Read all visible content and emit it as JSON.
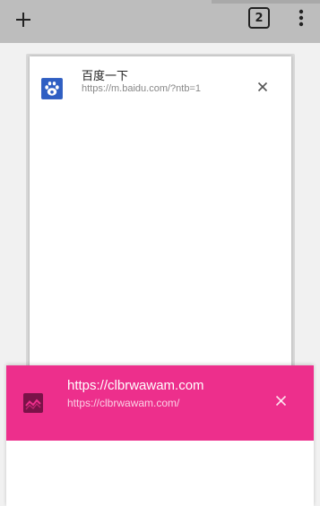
{
  "toolbar": {
    "new_tab_icon": "plus-icon",
    "tab_count": "2",
    "menu_icon": "more-vert-icon",
    "background_color": "#bdbdbd"
  },
  "tabs": [
    {
      "title": "百度一下",
      "url": "https://m.baidu.com/?ntb=1",
      "favicon": "baidu-paw-icon",
      "close_icon": "close-icon"
    },
    {
      "title": "https://clbrwawam.com",
      "url": "https://clbrwawam.com/",
      "favicon": "broken-image-icon",
      "close_icon": "close-icon",
      "theme_color": "#ed2f8c"
    }
  ]
}
